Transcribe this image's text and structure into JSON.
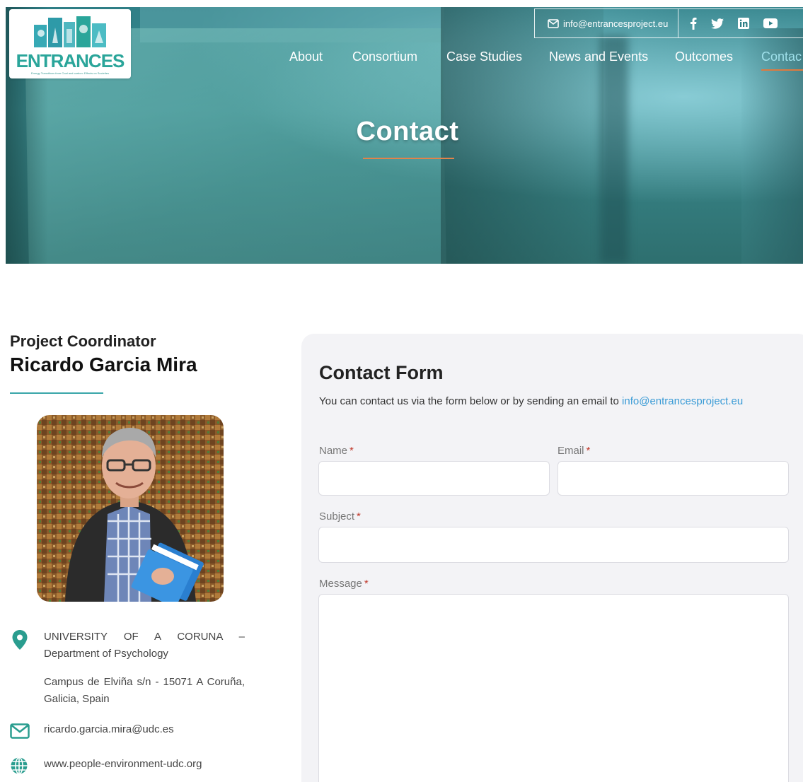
{
  "header": {
    "logo_text": "ENTRANCES",
    "logo_subtitle": "Energy Transitions from Coal and carbon: Effects on Societies",
    "email": "info@entrancesproject.eu",
    "social": [
      "facebook-icon",
      "twitter-icon",
      "linkedin-icon",
      "youtube-icon"
    ],
    "nav": [
      {
        "label": "About"
      },
      {
        "label": "Consortium"
      },
      {
        "label": "Case Studies"
      },
      {
        "label": "News and Events"
      },
      {
        "label": "Outcomes"
      },
      {
        "label": "Contac"
      }
    ],
    "active_nav": "Contac",
    "hero_title": "Contact",
    "accent_color": "#e07a3e"
  },
  "coordinator": {
    "label": "Project Coordinator",
    "name": "Ricardo Garcia Mira",
    "address_line1": "UNIVERSITY OF A CORUNA – Department of Psychology",
    "address_line2": "Campus de Elviña s/n - 15071 A Coruña, Galicia, Spain",
    "email": "ricardo.garcia.mira@udc.es",
    "website": "www.people-environment-udc.org",
    "icon_color": "#2a9d8f"
  },
  "form": {
    "title": "Contact Form",
    "desc_prefix": "You can contact us via the form below or by sending an email to ",
    "desc_link": "info@entrancesproject.eu",
    "name_label": "Name",
    "email_label": "Email",
    "subject_label": "Subject",
    "message_label": "Message",
    "required_mark": "*"
  }
}
